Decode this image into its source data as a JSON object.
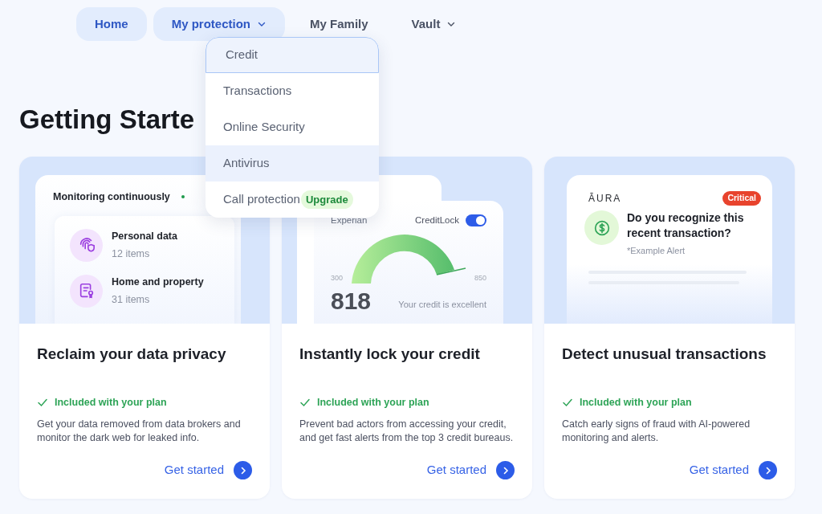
{
  "nav": [
    {
      "label": "Home",
      "selected": true,
      "has_menu": false
    },
    {
      "label": "My protection",
      "selected": true,
      "has_menu": true
    },
    {
      "label": "My Family",
      "selected": false,
      "has_menu": false
    },
    {
      "label": "Vault",
      "selected": false,
      "has_menu": true
    }
  ],
  "menu": [
    {
      "label": "Credit",
      "focused": true,
      "hovered": false
    },
    {
      "label": "Transactions",
      "focused": false,
      "hovered": false
    },
    {
      "label": "Online Security",
      "focused": false,
      "hovered": false
    },
    {
      "label": "Antivirus",
      "focused": false,
      "hovered": true
    },
    {
      "label": "Call protection",
      "focused": false,
      "hovered": false,
      "badge": "Upgrade"
    }
  ],
  "heading": "Getting Starte",
  "cards": [
    {
      "kind": "data",
      "title": "Reclaim your data privacy",
      "included": "Included with your plan",
      "description": "Get your data removed from data brokers and monitor the dark web for leaked info.",
      "cta": "Get started",
      "illustration": {
        "status": "Monitoring continuously",
        "items": [
          {
            "name": "Personal data",
            "count": "12 items"
          },
          {
            "name": "Home and property",
            "count": "31 items"
          }
        ]
      }
    },
    {
      "kind": "credit",
      "title": "Instantly lock your credit",
      "included": "Included with your plan",
      "description": "Prevent bad actors from accessing your credit, and get fast alerts from the top 3 credit bureaus.",
      "cta": "Get started",
      "illustration": {
        "bureau": "Experian",
        "lock_label": "CreditLock",
        "on": true,
        "min": "300",
        "max": "850",
        "score": "818",
        "rating": "Your credit is excellent"
      }
    },
    {
      "kind": "alert",
      "title": "Detect unusual transactions",
      "included": "Included with your plan",
      "description": "Catch early signs of fraud with AI-powered monitoring and alerts.",
      "cta": "Get started",
      "illustration": {
        "brand": "ĀURA",
        "badge": "Critical",
        "question": "Do you recognize this recent transaction?",
        "note": "*Example Alert"
      }
    }
  ]
}
